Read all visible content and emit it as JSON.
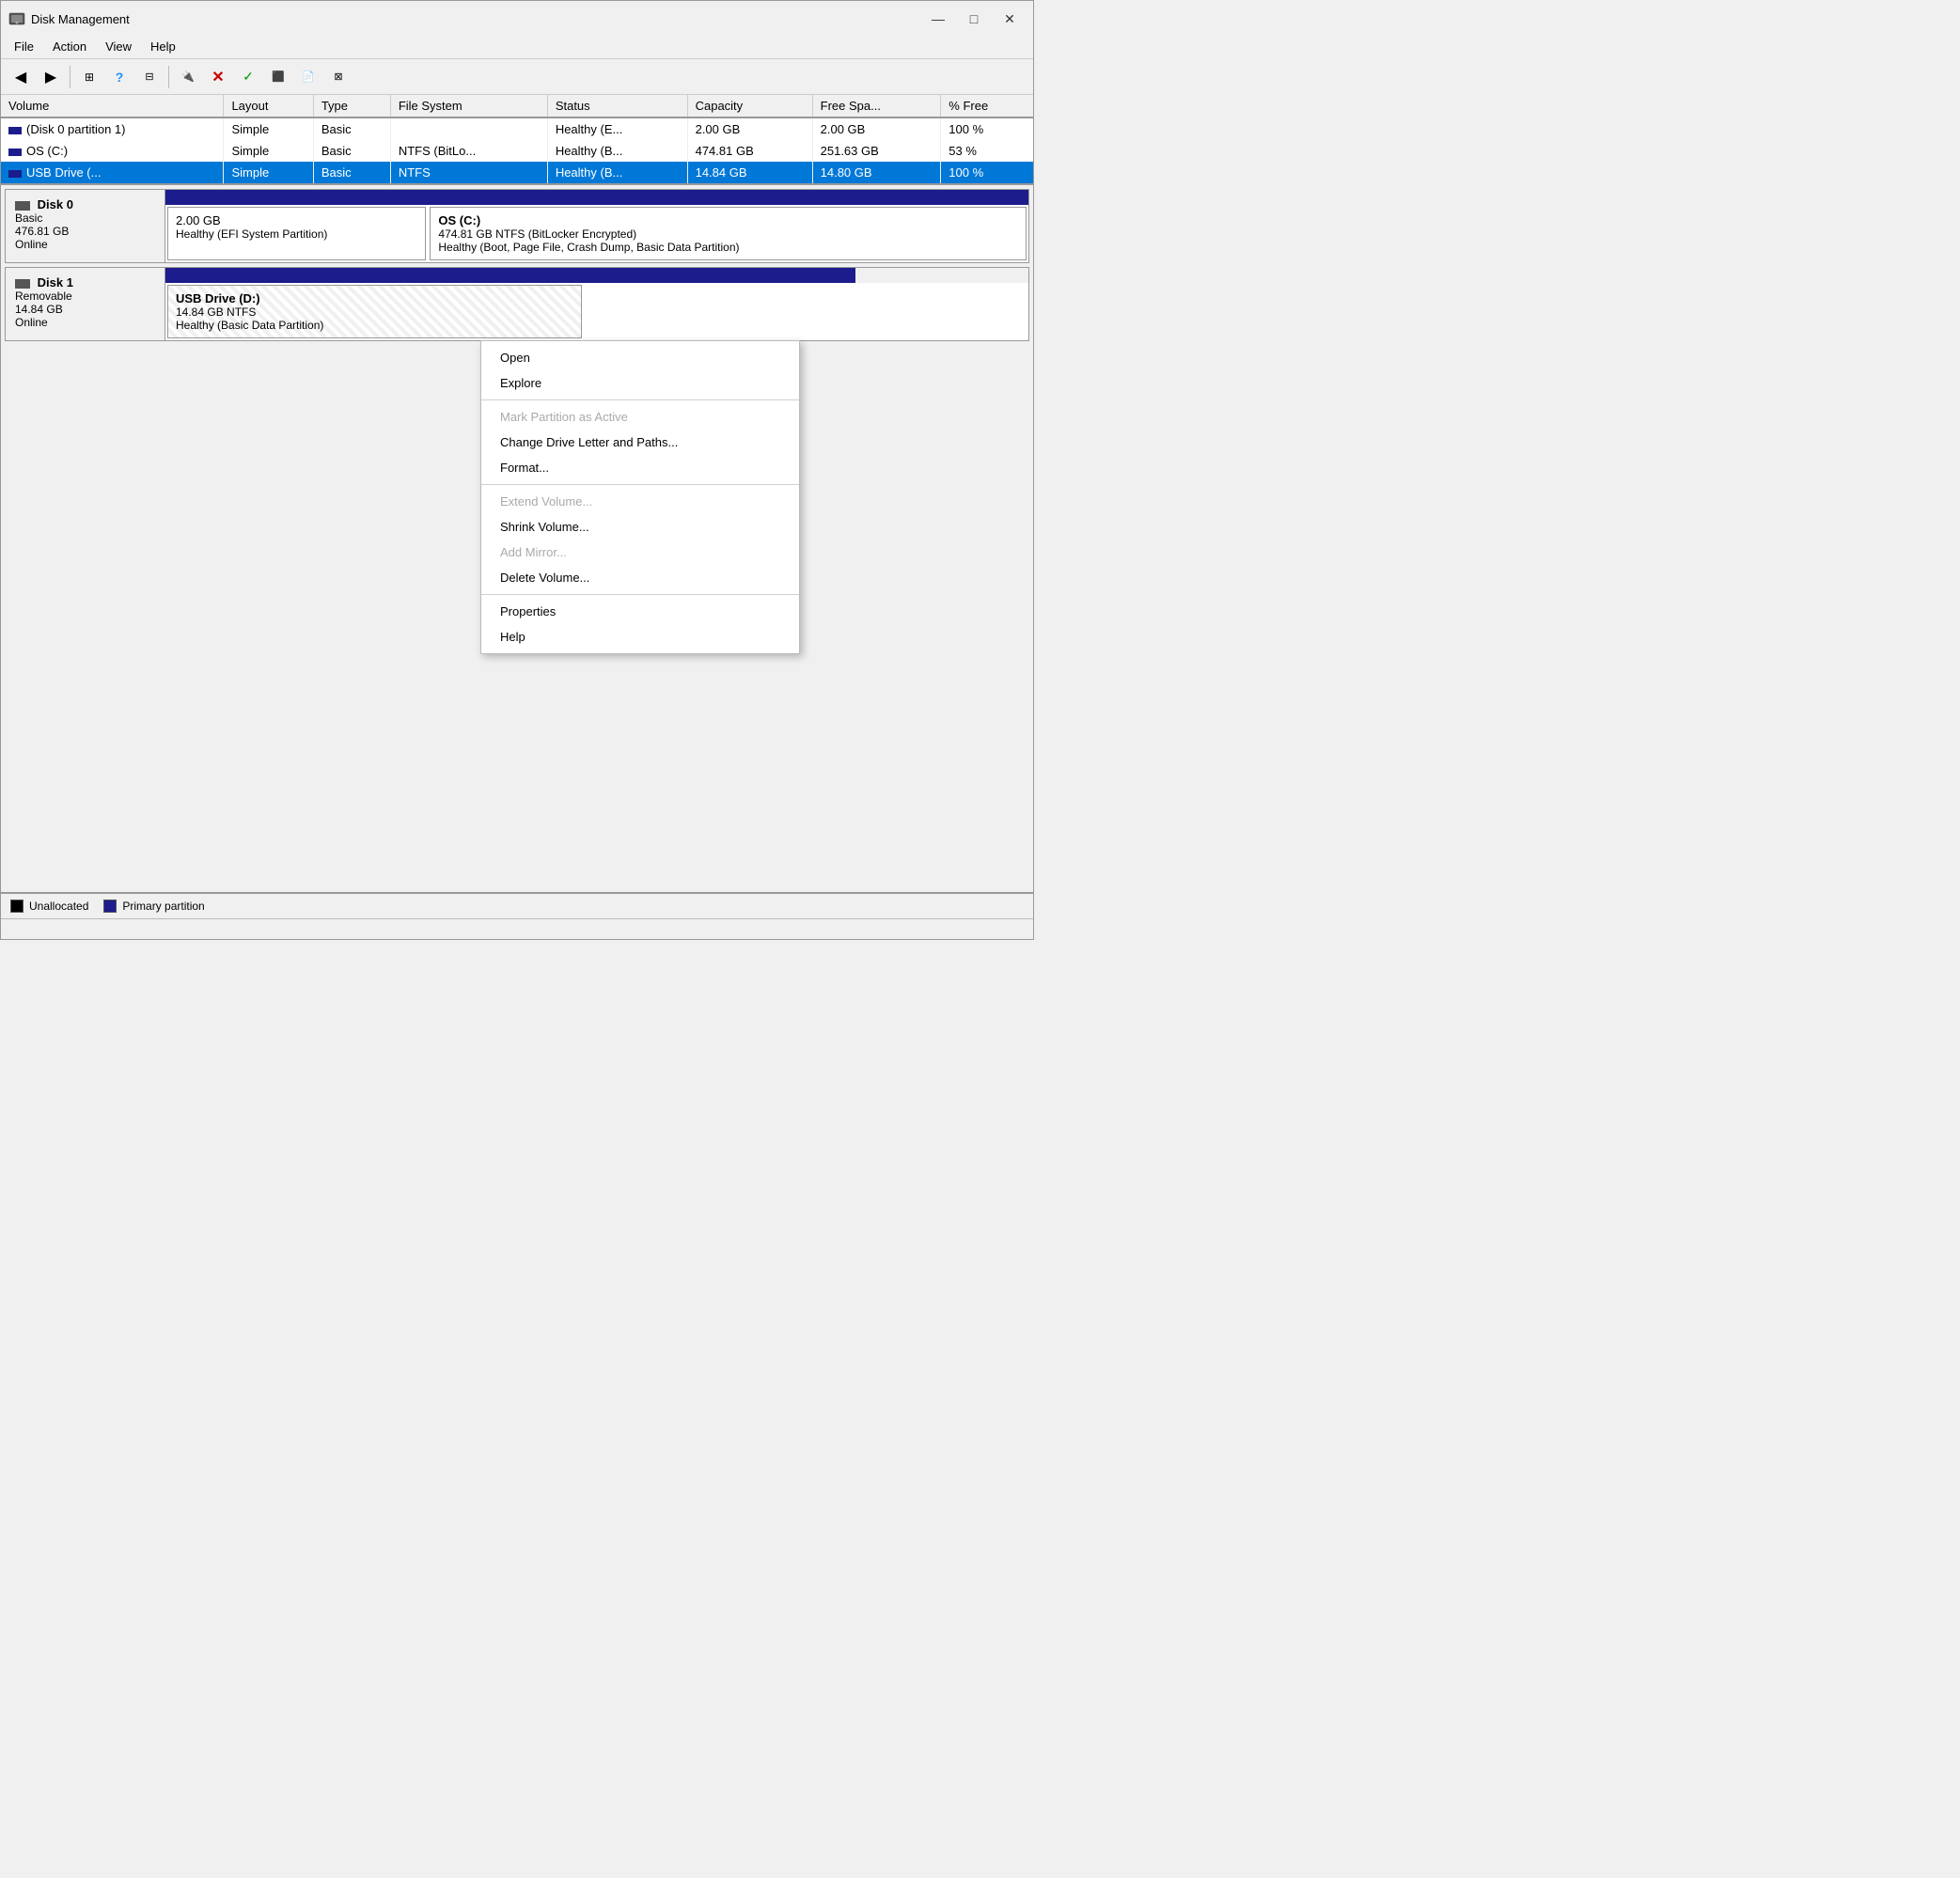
{
  "window": {
    "title": "Disk Management",
    "controls": {
      "minimize": "—",
      "maximize": "□",
      "close": "✕"
    }
  },
  "menu": {
    "items": [
      "File",
      "Action",
      "View",
      "Help"
    ]
  },
  "toolbar": {
    "buttons": [
      {
        "icon": "◀",
        "name": "back-btn",
        "title": "Back"
      },
      {
        "icon": "▶",
        "name": "forward-btn",
        "title": "Forward"
      },
      {
        "icon": "⊞",
        "name": "view-btn",
        "title": "View"
      },
      {
        "icon": "?",
        "name": "help-btn",
        "title": "Help"
      },
      {
        "icon": "⊟",
        "name": "console-btn",
        "title": "Console"
      },
      {
        "icon": "✱",
        "name": "connect-btn",
        "title": "Connect"
      },
      {
        "icon": "✕",
        "name": "delete-btn",
        "title": "Delete"
      },
      {
        "icon": "✓",
        "name": "check-btn",
        "title": "Check"
      },
      {
        "icon": "⬛",
        "name": "refresh-btn",
        "title": "Refresh"
      },
      {
        "icon": "⬜",
        "name": "export-btn",
        "title": "Export"
      },
      {
        "icon": "⊠",
        "name": "more-btn",
        "title": "More"
      }
    ]
  },
  "table": {
    "columns": [
      "Volume",
      "Layout",
      "Type",
      "File System",
      "Status",
      "Capacity",
      "Free Spa...",
      "% Free"
    ],
    "rows": [
      {
        "volume": "(Disk 0 partition 1)",
        "layout": "Simple",
        "type": "Basic",
        "filesystem": "",
        "status": "Healthy (E...",
        "capacity": "2.00 GB",
        "free": "2.00 GB",
        "pct_free": "100 %"
      },
      {
        "volume": "OS (C:)",
        "layout": "Simple",
        "type": "Basic",
        "filesystem": "NTFS (BitLo...",
        "status": "Healthy (B...",
        "capacity": "474.81 GB",
        "free": "251.63 GB",
        "pct_free": "53 %"
      },
      {
        "volume": "USB Drive (...",
        "layout": "Simple",
        "type": "Basic",
        "filesystem": "NTFS",
        "status": "Healthy (B...",
        "capacity": "14.84 GB",
        "free": "14.80 GB",
        "pct_free": "100 %"
      }
    ]
  },
  "disks": [
    {
      "id": "disk0",
      "name": "Disk 0",
      "type": "Basic",
      "size": "476.81 GB",
      "status": "Online",
      "partitions": [
        {
          "id": "disk0-part1",
          "label": "",
          "size": "2.00 GB",
          "info": "Healthy (EFI System Partition)",
          "width_pct": 30
        },
        {
          "id": "disk0-part2",
          "label": "OS  (C:)",
          "size": "474.81 GB NTFS (BitLocker Encrypted)",
          "info": "Healthy (Boot, Page File, Crash Dump, Basic Data Partition)",
          "width_pct": 70
        }
      ]
    },
    {
      "id": "disk1",
      "name": "Disk 1",
      "type": "Removable",
      "size": "14.84 GB",
      "status": "Online",
      "partitions": [
        {
          "id": "disk1-part1",
          "label": "USB Drive  (D:)",
          "size": "14.84 GB NTFS",
          "info": "Healthy (Basic Data Partition)",
          "width_pct": 48
        }
      ]
    }
  ],
  "context_menu": {
    "items": [
      {
        "label": "Open",
        "disabled": false,
        "separator_after": false
      },
      {
        "label": "Explore",
        "disabled": false,
        "separator_after": true
      },
      {
        "label": "Mark Partition as Active",
        "disabled": true,
        "separator_after": false
      },
      {
        "label": "Change Drive Letter and Paths...",
        "disabled": false,
        "separator_after": false
      },
      {
        "label": "Format...",
        "disabled": false,
        "separator_after": true
      },
      {
        "label": "Extend Volume...",
        "disabled": true,
        "separator_after": false
      },
      {
        "label": "Shrink Volume...",
        "disabled": false,
        "separator_after": false
      },
      {
        "label": "Add Mirror...",
        "disabled": true,
        "separator_after": false
      },
      {
        "label": "Delete Volume...",
        "disabled": false,
        "separator_after": true
      },
      {
        "label": "Properties",
        "disabled": false,
        "separator_after": false
      },
      {
        "label": "Help",
        "disabled": false,
        "separator_after": false
      }
    ]
  },
  "legend": {
    "items": [
      {
        "label": "Unallocated",
        "color": "black"
      },
      {
        "label": "Primary partition",
        "color": "blue"
      }
    ]
  }
}
